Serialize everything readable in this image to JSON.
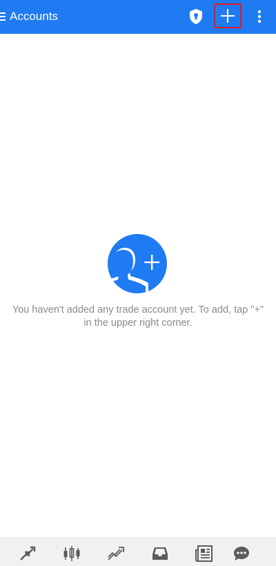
{
  "header": {
    "title": "Accounts",
    "menu_icon": "hamburger-menu-icon",
    "shield_icon": "shield-lock-icon",
    "add_icon": "plus-icon",
    "more_icon": "more-vertical-icon"
  },
  "empty_state": {
    "icon": "add-user-icon",
    "message_line1": "You haven't added any trade account yet. To add, tap \"+\"",
    "message_line2": "in the upper right corner."
  },
  "bottom_nav": {
    "items": [
      {
        "id": "quotes",
        "icon": "quotes-arrows-icon"
      },
      {
        "id": "chart",
        "icon": "candlestick-chart-icon"
      },
      {
        "id": "trade",
        "icon": "trade-trend-icon"
      },
      {
        "id": "history",
        "icon": "inbox-tray-icon"
      },
      {
        "id": "news",
        "icon": "newspaper-icon"
      },
      {
        "id": "messages",
        "icon": "chat-bubble-icon"
      }
    ]
  },
  "colors": {
    "primary": "#1f7bf2",
    "highlight_border": "#e01b24",
    "text_muted": "#8a8a8a",
    "nav_icon": "#5b5b5b",
    "nav_background": "#f1f1f1"
  }
}
